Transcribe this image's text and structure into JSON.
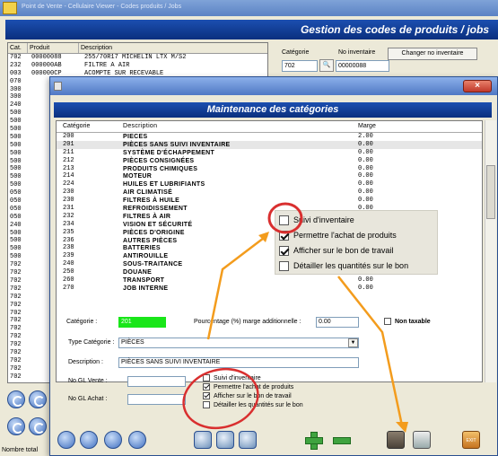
{
  "app": {
    "window_title": "Point de Vente - Cellulaire Viewer - Codes produits / Jobs"
  },
  "main": {
    "header_title": "Gestion des codes de produits / jobs",
    "columns": [
      "Cat.",
      "Produit",
      "Description"
    ],
    "rows": [
      [
        "702",
        "00000088",
        "255/70R17 MICHELIN LTX M/S2"
      ],
      [
        "232",
        "000000AB",
        "FILTRE A AIR"
      ],
      [
        "003",
        "000000CP",
        "ACOMPTE SUR RECEVABLE"
      ],
      [
        "070",
        "",
        ""
      ],
      [
        "300",
        "",
        ""
      ],
      [
        "300",
        "",
        ""
      ],
      [
        "240",
        "",
        ""
      ],
      [
        "500",
        "",
        ""
      ],
      [
        "500",
        "",
        ""
      ],
      [
        "500",
        "",
        ""
      ],
      [
        "500",
        "",
        ""
      ],
      [
        "500",
        "",
        ""
      ],
      [
        "500",
        "",
        ""
      ],
      [
        "500",
        "",
        ""
      ],
      [
        "500",
        "",
        ""
      ],
      [
        "500",
        "",
        ""
      ],
      [
        "500",
        "",
        ""
      ],
      [
        "050",
        "",
        ""
      ],
      [
        "050",
        "",
        ""
      ],
      [
        "050",
        "",
        ""
      ],
      [
        "050",
        "",
        ""
      ],
      [
        "240",
        "",
        ""
      ],
      [
        "500",
        "",
        ""
      ],
      [
        "500",
        "",
        ""
      ],
      [
        "500",
        "",
        ""
      ],
      [
        "500",
        "",
        ""
      ],
      [
        "702",
        "",
        ""
      ],
      [
        "702",
        "",
        ""
      ],
      [
        "702",
        "",
        ""
      ],
      [
        "702",
        "",
        ""
      ],
      [
        "702",
        "",
        ""
      ],
      [
        "702",
        "",
        ""
      ],
      [
        "702",
        "",
        ""
      ],
      [
        "702",
        "",
        ""
      ],
      [
        "702",
        "",
        ""
      ],
      [
        "702",
        "",
        ""
      ],
      [
        "702",
        "",
        ""
      ],
      [
        "702",
        "",
        ""
      ],
      [
        "702",
        "",
        ""
      ],
      [
        "702",
        "",
        ""
      ],
      [
        "702",
        "",
        ""
      ]
    ],
    "categorie_label": "Catégorie",
    "categorie_value": "702",
    "no_inventaire_label": "No inventaire",
    "no_inventaire_value": "00000088",
    "changer_button": "Changer no inventaire",
    "status_text": "Nombre total"
  },
  "dialog": {
    "title": "Maintenance des catégories",
    "columns": [
      "Catégorie",
      "Description",
      "Marge"
    ],
    "rows": [
      [
        "200",
        "PIECES",
        "2.00"
      ],
      [
        "201",
        "PIÈCES SANS SUIVI INVENTAIRE",
        "0.00"
      ],
      [
        "211",
        "SYSTÈME D'ÉCHAPPEMENT",
        "0.00"
      ],
      [
        "212",
        "PIÈCES CONSIGNÉES",
        "0.00"
      ],
      [
        "213",
        "PRODUITS CHIMIQUES",
        "0.00"
      ],
      [
        "214",
        "MOTEUR",
        "0.00"
      ],
      [
        "224",
        "HUILES ET LUBRIFIANTS",
        "0.00"
      ],
      [
        "230",
        "AIR CLIMATISÉ",
        "0.00"
      ],
      [
        "230",
        "FILTRES À HUILE",
        "0.00"
      ],
      [
        "231",
        "REFROIDISSEMENT",
        "0.00"
      ],
      [
        "232",
        "FILTRES À AIR",
        "0.00"
      ],
      [
        "234",
        "VISION ET SÉCURITÉ",
        "0.00"
      ],
      [
        "235",
        "PIÈCES D'ORIGINE",
        "0.00"
      ],
      [
        "236",
        "AUTRES PIÈCES",
        "0.00"
      ],
      [
        "238",
        "BATTERIES",
        "0.00"
      ],
      [
        "239",
        "ANTIROUILLE",
        "0.00"
      ],
      [
        "240",
        "SOUS-TRAITANCE",
        "0.00"
      ],
      [
        "250",
        "DOUANE",
        "0.00"
      ],
      [
        "260",
        "TRANSPORT",
        "0.00"
      ],
      [
        "270",
        "JOB INTERNE",
        "0.00"
      ]
    ],
    "selected_index": 1,
    "callout_checkboxes": [
      {
        "label": "Suivi d'inventaire",
        "checked": false
      },
      {
        "label": "Permettre l'achat de produits",
        "checked": true
      },
      {
        "label": "Afficher sur le bon de travail",
        "checked": true
      },
      {
        "label": "Détailler les quantités sur le bon",
        "checked": false
      }
    ],
    "form": {
      "categorie_label": "Catégorie :",
      "categorie_value": "201",
      "marge_label": "Pourcentage (%) marge additionnelle :",
      "marge_value": "0.00",
      "non_taxable_label": "Non taxable",
      "type_label": "Type Catégorie :",
      "type_value": "PIÈCES",
      "description_label": "Description :",
      "description_value": "PIÈCES SANS SUIVI INVENTAIRE",
      "gl_vente_label": "No GL Vente :",
      "gl_achat_label": "No GL Achat :",
      "checkboxes": [
        {
          "label": "Suivi d'inventaire",
          "checked": false
        },
        {
          "label": "Permettre l'achat de produits",
          "checked": true
        },
        {
          "label": "Afficher sur le bon de travail",
          "checked": true
        },
        {
          "label": "Détailler les quantités sur le bon",
          "checked": false
        }
      ]
    },
    "exit_label": "EXIT"
  },
  "colors": {
    "header_blue": "#0a2f7e",
    "annotation_orange": "#f39c1d",
    "annotation_red": "#d92f2f",
    "category_green": "#19e619"
  },
  "icons": [
    "first-icon",
    "previous-icon",
    "next-icon",
    "last-icon",
    "search-icon",
    "zoom-icon",
    "find-icon",
    "add-icon",
    "remove-icon",
    "save-icon",
    "print-icon",
    "exit-icon",
    "close-icon"
  ]
}
